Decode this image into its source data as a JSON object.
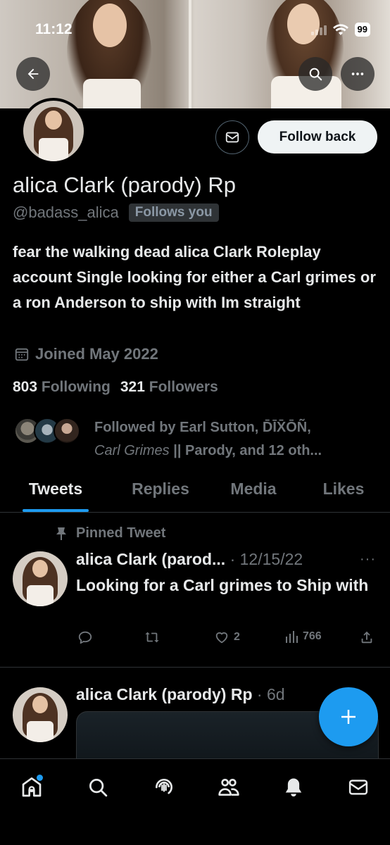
{
  "status_bar": {
    "time": "11:12",
    "battery": "99"
  },
  "profile": {
    "display_name": "alica Clark (parody) Rp",
    "handle": "@badass_alica",
    "follows_badge": "Follows you",
    "follow_button": "Follow back",
    "bio": "fear the walking dead alica Clark Roleplay account Single looking for either a Carl grimes or a ron Anderson to ship with Im straight",
    "joined": "Joined May 2022",
    "following_count": "803",
    "following_label": "Following",
    "followers_count": "321",
    "followers_label": "Followers",
    "followed_by_prefix": "Followed by Earl Sutton, D̄ĪX̄ŌÑ,",
    "followed_by_italic": "Carl Grimes",
    "followed_by_suffix": " || Parody, and 12 oth..."
  },
  "tabs": [
    "Tweets",
    "Replies",
    "Media",
    "Likes"
  ],
  "tweets": [
    {
      "pinned_label": "Pinned Tweet",
      "author": "alica Clark (parod...",
      "meta": " · 12/15/22",
      "text": "Looking for a Carl grimes to Ship with",
      "likes": "2",
      "views": "766"
    },
    {
      "author": "alica Clark (parody) Rp",
      "meta": " · 6d"
    }
  ],
  "more_glyph": "···",
  "fab_icon": "plus-icon",
  "nav_icons": [
    "home-icon",
    "search-icon",
    "spaces-icon",
    "communities-icon",
    "notifications-icon",
    "messages-icon"
  ],
  "colors": {
    "accent": "#1d9bf0",
    "background": "#000000",
    "muted": "#71767b"
  }
}
